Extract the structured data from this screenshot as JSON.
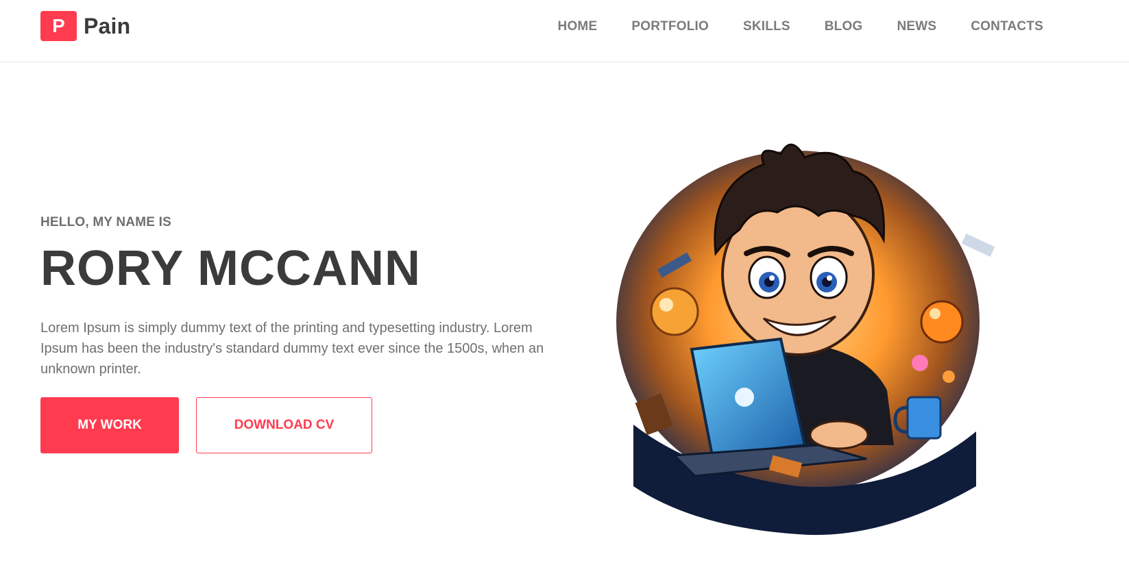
{
  "header": {
    "logo_letter": "P",
    "logo_text": "Pain",
    "nav": [
      "HOME",
      "PORTFOLIO",
      "SKILLS",
      "BLOG",
      "NEWS",
      "CONTACTS"
    ]
  },
  "hero": {
    "eyebrow": "HELLO, MY NAME IS",
    "name": "RORY MCCANN",
    "description": "Lorem Ipsum is simply dummy text of the printing and typesetting industry. Lorem Ipsum has been the industry's standard dummy text ever since the 1500s, when an unknown printer.",
    "primary_button": "MY WORK",
    "secondary_button": "DOWNLOAD CV"
  },
  "colors": {
    "accent": "#ff3b50",
    "heading": "#3b3b3b",
    "body_text": "#6f6f6f",
    "nav_text": "#7b7b7b"
  }
}
